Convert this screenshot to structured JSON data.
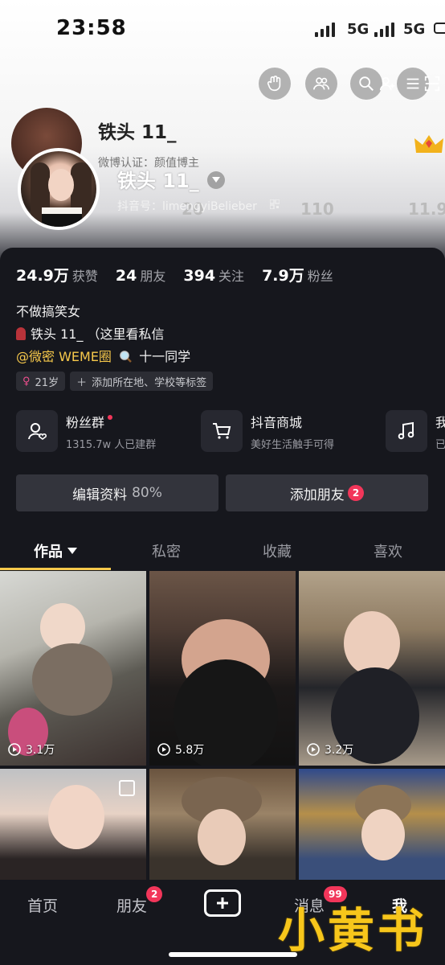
{
  "status_bar": {
    "time": "23:58",
    "network": "5G"
  },
  "ghost_layer": {
    "name": "铁头 11_",
    "certification": "微博认证：颜值博主",
    "numbers": [
      "20",
      "110",
      "11.9"
    ]
  },
  "profile": {
    "name": "铁头 11_",
    "douyin_id": "抖音号：limengyiBelieber",
    "stats": [
      {
        "value": "24.9万",
        "label": "获赞"
      },
      {
        "value": "24",
        "label": "朋友"
      },
      {
        "value": "394",
        "label": "关注"
      },
      {
        "value": "7.9万",
        "label": "粉丝"
      }
    ],
    "bio": {
      "line1": "不做搞笑女",
      "line2": "铁头 11_ （这里看私信",
      "line3_mention": "@微密 WEME圈",
      "line3_rest": "十一同学"
    },
    "tags": [
      {
        "icon": "female-icon",
        "text": "21岁"
      },
      {
        "icon": "plus-icon",
        "text": "添加所在地、学校等标签"
      }
    ]
  },
  "services": [
    {
      "icon": "fan-group-icon",
      "title": "粉丝群",
      "subtitle": "1315.7w 人已建群",
      "has_dot": true
    },
    {
      "icon": "cart-icon",
      "title": "抖音商城",
      "subtitle": "美好生活触手可得",
      "has_dot": false
    },
    {
      "icon": "music-icon",
      "title": "我",
      "subtitle": "已",
      "has_dot": false
    }
  ],
  "buttons": {
    "edit_profile": "编辑资料",
    "edit_profile_pct": "80%",
    "add_friend": "添加朋友",
    "add_friend_badge": "2"
  },
  "tabs": [
    {
      "label": "作品",
      "active": true
    },
    {
      "label": "私密",
      "active": false
    },
    {
      "label": "收藏",
      "active": false
    },
    {
      "label": "喜欢",
      "active": false
    }
  ],
  "videos": [
    {
      "views": "3.1万"
    },
    {
      "views": "5.8万"
    },
    {
      "views": "3.2万"
    },
    {
      "views": ""
    },
    {
      "views": ""
    },
    {
      "views": ""
    }
  ],
  "bottom_nav": {
    "home": "首页",
    "friends": "朋友",
    "friends_badge": "2",
    "messages": "消息",
    "messages_badge": "99",
    "me": "我"
  },
  "watermark": "小黄书",
  "colors": {
    "accent_yellow": "#f7c94b",
    "badge_red": "#f2365a",
    "panel_bg": "#16171d"
  }
}
